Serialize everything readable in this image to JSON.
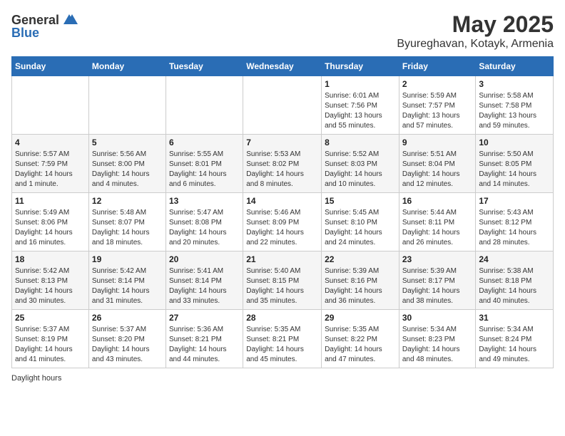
{
  "header": {
    "logo_general": "General",
    "logo_blue": "Blue",
    "month": "May 2025",
    "location": "Byureghavan, Kotayk, Armenia"
  },
  "days_header": [
    "Sunday",
    "Monday",
    "Tuesday",
    "Wednesday",
    "Thursday",
    "Friday",
    "Saturday"
  ],
  "weeks": [
    [
      {
        "day": "",
        "info": ""
      },
      {
        "day": "",
        "info": ""
      },
      {
        "day": "",
        "info": ""
      },
      {
        "day": "",
        "info": ""
      },
      {
        "day": "1",
        "info": "Sunrise: 6:01 AM\nSunset: 7:56 PM\nDaylight: 13 hours\nand 55 minutes."
      },
      {
        "day": "2",
        "info": "Sunrise: 5:59 AM\nSunset: 7:57 PM\nDaylight: 13 hours\nand 57 minutes."
      },
      {
        "day": "3",
        "info": "Sunrise: 5:58 AM\nSunset: 7:58 PM\nDaylight: 13 hours\nand 59 minutes."
      }
    ],
    [
      {
        "day": "4",
        "info": "Sunrise: 5:57 AM\nSunset: 7:59 PM\nDaylight: 14 hours\nand 1 minute."
      },
      {
        "day": "5",
        "info": "Sunrise: 5:56 AM\nSunset: 8:00 PM\nDaylight: 14 hours\nand 4 minutes."
      },
      {
        "day": "6",
        "info": "Sunrise: 5:55 AM\nSunset: 8:01 PM\nDaylight: 14 hours\nand 6 minutes."
      },
      {
        "day": "7",
        "info": "Sunrise: 5:53 AM\nSunset: 8:02 PM\nDaylight: 14 hours\nand 8 minutes."
      },
      {
        "day": "8",
        "info": "Sunrise: 5:52 AM\nSunset: 8:03 PM\nDaylight: 14 hours\nand 10 minutes."
      },
      {
        "day": "9",
        "info": "Sunrise: 5:51 AM\nSunset: 8:04 PM\nDaylight: 14 hours\nand 12 minutes."
      },
      {
        "day": "10",
        "info": "Sunrise: 5:50 AM\nSunset: 8:05 PM\nDaylight: 14 hours\nand 14 minutes."
      }
    ],
    [
      {
        "day": "11",
        "info": "Sunrise: 5:49 AM\nSunset: 8:06 PM\nDaylight: 14 hours\nand 16 minutes."
      },
      {
        "day": "12",
        "info": "Sunrise: 5:48 AM\nSunset: 8:07 PM\nDaylight: 14 hours\nand 18 minutes."
      },
      {
        "day": "13",
        "info": "Sunrise: 5:47 AM\nSunset: 8:08 PM\nDaylight: 14 hours\nand 20 minutes."
      },
      {
        "day": "14",
        "info": "Sunrise: 5:46 AM\nSunset: 8:09 PM\nDaylight: 14 hours\nand 22 minutes."
      },
      {
        "day": "15",
        "info": "Sunrise: 5:45 AM\nSunset: 8:10 PM\nDaylight: 14 hours\nand 24 minutes."
      },
      {
        "day": "16",
        "info": "Sunrise: 5:44 AM\nSunset: 8:11 PM\nDaylight: 14 hours\nand 26 minutes."
      },
      {
        "day": "17",
        "info": "Sunrise: 5:43 AM\nSunset: 8:12 PM\nDaylight: 14 hours\nand 28 minutes."
      }
    ],
    [
      {
        "day": "18",
        "info": "Sunrise: 5:42 AM\nSunset: 8:13 PM\nDaylight: 14 hours\nand 30 minutes."
      },
      {
        "day": "19",
        "info": "Sunrise: 5:42 AM\nSunset: 8:14 PM\nDaylight: 14 hours\nand 31 minutes."
      },
      {
        "day": "20",
        "info": "Sunrise: 5:41 AM\nSunset: 8:14 PM\nDaylight: 14 hours\nand 33 minutes."
      },
      {
        "day": "21",
        "info": "Sunrise: 5:40 AM\nSunset: 8:15 PM\nDaylight: 14 hours\nand 35 minutes."
      },
      {
        "day": "22",
        "info": "Sunrise: 5:39 AM\nSunset: 8:16 PM\nDaylight: 14 hours\nand 36 minutes."
      },
      {
        "day": "23",
        "info": "Sunrise: 5:39 AM\nSunset: 8:17 PM\nDaylight: 14 hours\nand 38 minutes."
      },
      {
        "day": "24",
        "info": "Sunrise: 5:38 AM\nSunset: 8:18 PM\nDaylight: 14 hours\nand 40 minutes."
      }
    ],
    [
      {
        "day": "25",
        "info": "Sunrise: 5:37 AM\nSunset: 8:19 PM\nDaylight: 14 hours\nand 41 minutes."
      },
      {
        "day": "26",
        "info": "Sunrise: 5:37 AM\nSunset: 8:20 PM\nDaylight: 14 hours\nand 43 minutes."
      },
      {
        "day": "27",
        "info": "Sunrise: 5:36 AM\nSunset: 8:21 PM\nDaylight: 14 hours\nand 44 minutes."
      },
      {
        "day": "28",
        "info": "Sunrise: 5:35 AM\nSunset: 8:21 PM\nDaylight: 14 hours\nand 45 minutes."
      },
      {
        "day": "29",
        "info": "Sunrise: 5:35 AM\nSunset: 8:22 PM\nDaylight: 14 hours\nand 47 minutes."
      },
      {
        "day": "30",
        "info": "Sunrise: 5:34 AM\nSunset: 8:23 PM\nDaylight: 14 hours\nand 48 minutes."
      },
      {
        "day": "31",
        "info": "Sunrise: 5:34 AM\nSunset: 8:24 PM\nDaylight: 14 hours\nand 49 minutes."
      }
    ]
  ],
  "footer": {
    "text": "Daylight hours"
  }
}
